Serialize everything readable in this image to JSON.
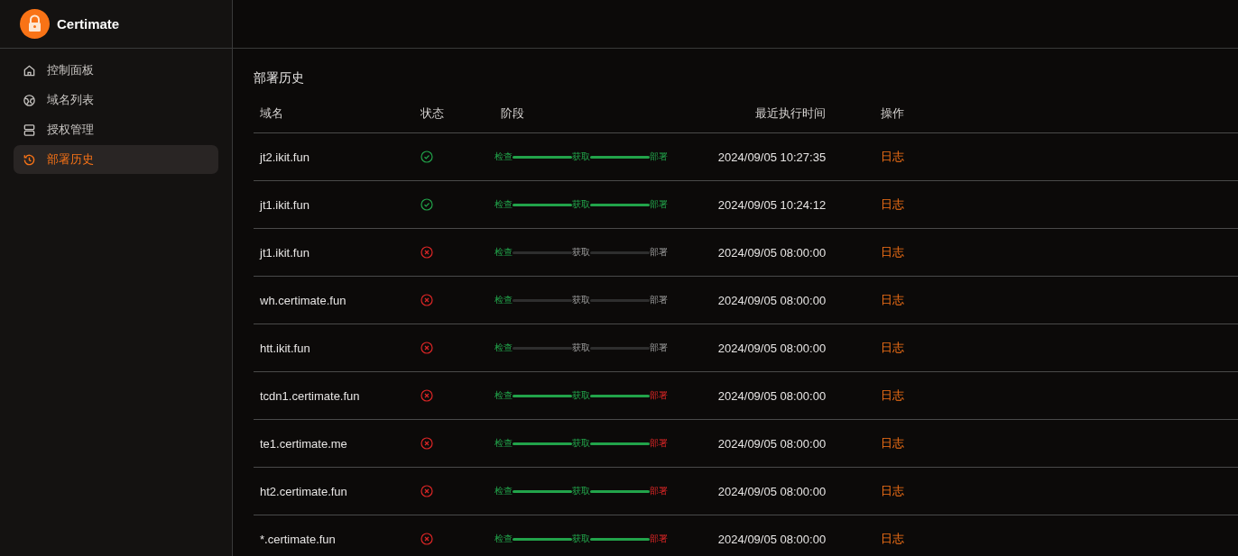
{
  "app": {
    "name": "Certimate"
  },
  "sidebar": {
    "items": [
      {
        "label": "控制面板",
        "selected": false
      },
      {
        "label": "域名列表",
        "selected": false
      },
      {
        "label": "授权管理",
        "selected": false
      },
      {
        "label": "部署历史",
        "selected": true
      }
    ]
  },
  "page": {
    "title": "部署历史"
  },
  "table": {
    "columns": [
      "域名",
      "状态",
      "阶段",
      "最近执行时间",
      "操作"
    ],
    "rows": [
      {
        "domain": "jt2.ikit.fun",
        "kind": "success",
        "stages": [
          {
            "label": "检查",
            "kind": "ok"
          },
          {
            "label": "获取",
            "kind": "ok"
          },
          {
            "label": "部署",
            "kind": "ok"
          }
        ],
        "time": "2024/09/05 10:27:35",
        "action": "日志"
      },
      {
        "domain": "jt1.ikit.fun",
        "kind": "success",
        "stages": [
          {
            "label": "检查",
            "kind": "ok"
          },
          {
            "label": "获取",
            "kind": "ok"
          },
          {
            "label": "部署",
            "kind": "ok"
          }
        ],
        "time": "2024/09/05 10:24:12",
        "action": "日志"
      },
      {
        "domain": "jt1.ikit.fun",
        "kind": "failed",
        "stages": [
          {
            "label": "检查",
            "kind": "ok"
          },
          {
            "label": "获取",
            "kind": "none"
          },
          {
            "label": "部署",
            "kind": "none"
          }
        ],
        "time": "2024/09/05 08:00:00",
        "action": "日志"
      },
      {
        "domain": "wh.certimate.fun",
        "kind": "failed",
        "stages": [
          {
            "label": "检查",
            "kind": "ok"
          },
          {
            "label": "获取",
            "kind": "none"
          },
          {
            "label": "部署",
            "kind": "none"
          }
        ],
        "time": "2024/09/05 08:00:00",
        "action": "日志"
      },
      {
        "domain": "htt.ikit.fun",
        "kind": "failed",
        "stages": [
          {
            "label": "检查",
            "kind": "ok"
          },
          {
            "label": "获取",
            "kind": "none"
          },
          {
            "label": "部署",
            "kind": "none"
          }
        ],
        "time": "2024/09/05 08:00:00",
        "action": "日志"
      },
      {
        "domain": "tcdn1.certimate.fun",
        "kind": "failed",
        "stages": [
          {
            "label": "检查",
            "kind": "ok"
          },
          {
            "label": "获取",
            "kind": "ok"
          },
          {
            "label": "部署",
            "kind": "fail"
          }
        ],
        "time": "2024/09/05 08:00:00",
        "action": "日志"
      },
      {
        "domain": "te1.certimate.me",
        "kind": "failed",
        "stages": [
          {
            "label": "检查",
            "kind": "ok"
          },
          {
            "label": "获取",
            "kind": "ok"
          },
          {
            "label": "部署",
            "kind": "fail"
          }
        ],
        "time": "2024/09/05 08:00:00",
        "action": "日志"
      },
      {
        "domain": "ht2.certimate.fun",
        "kind": "failed",
        "stages": [
          {
            "label": "检查",
            "kind": "ok"
          },
          {
            "label": "获取",
            "kind": "ok"
          },
          {
            "label": "部署",
            "kind": "fail"
          }
        ],
        "time": "2024/09/05 08:00:00",
        "action": "日志"
      },
      {
        "domain": "*.certimate.fun",
        "kind": "failed",
        "stages": [
          {
            "label": "检查",
            "kind": "ok"
          },
          {
            "label": "获取",
            "kind": "ok"
          },
          {
            "label": "部署",
            "kind": "fail"
          }
        ],
        "time": "2024/09/05 08:00:00",
        "action": "日志"
      }
    ]
  }
}
